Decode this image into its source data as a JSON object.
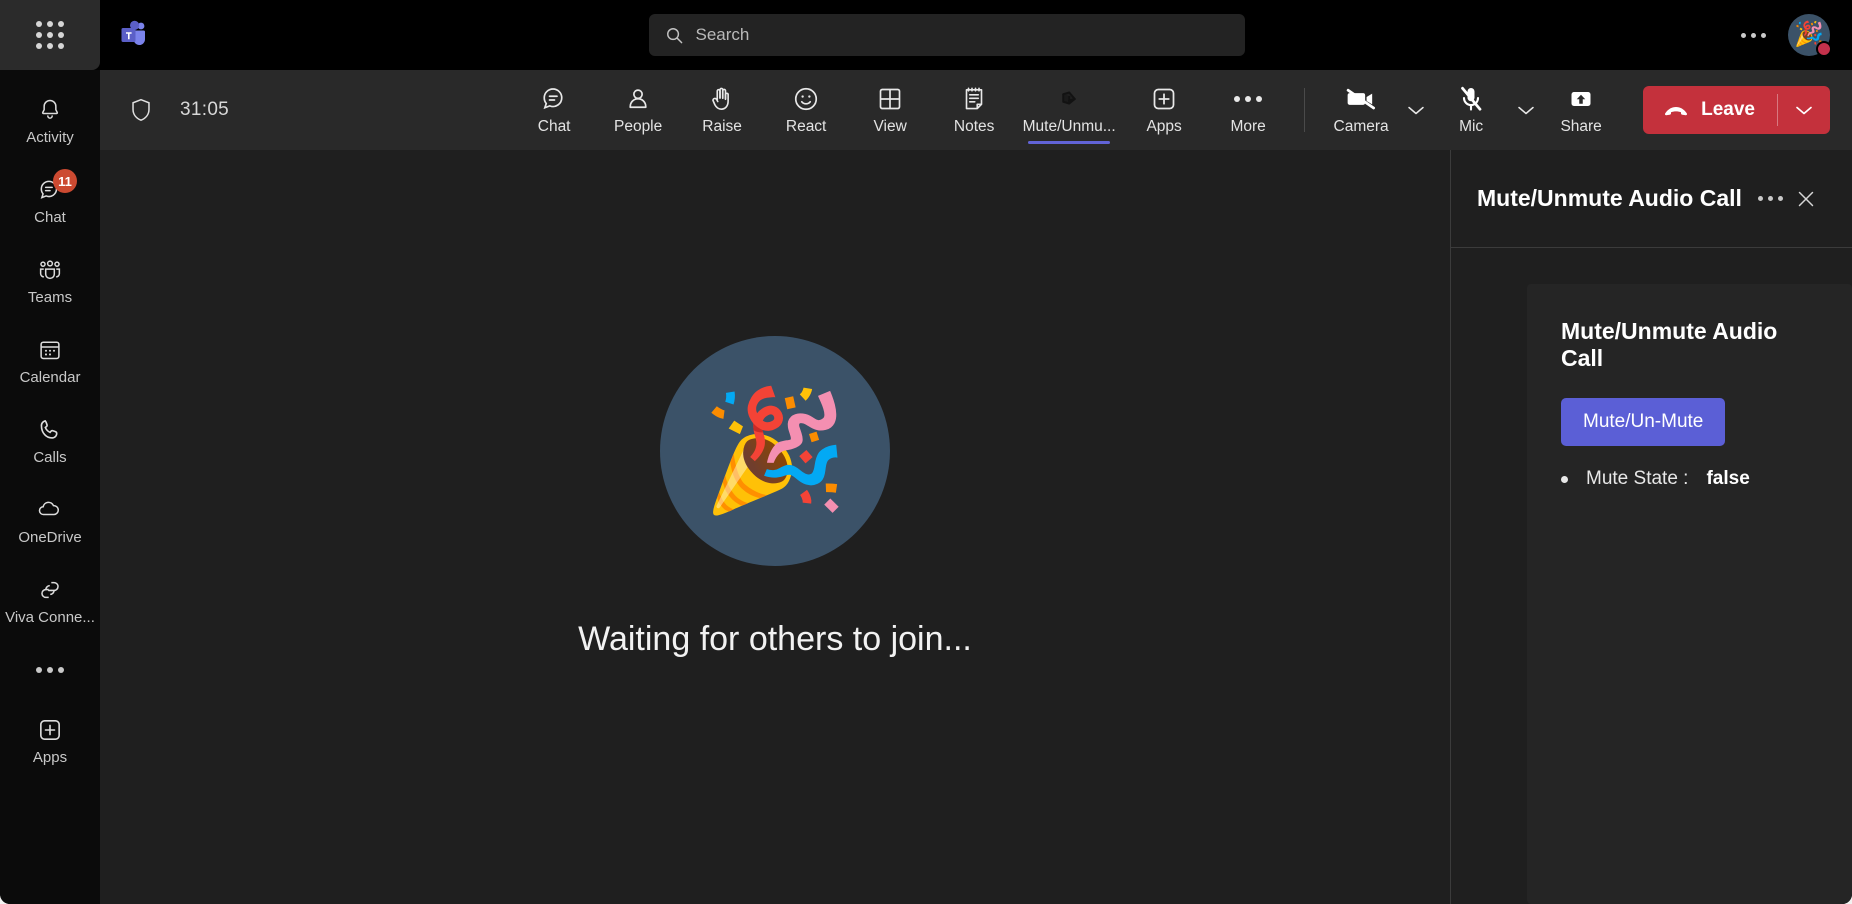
{
  "app": {
    "waffle_icon": "grid-waffle-icon",
    "logo_icon": "microsoft-teams-logo"
  },
  "search": {
    "placeholder": "Search",
    "value": "",
    "icon": "search-icon"
  },
  "titlebar": {
    "more_icon": "ellipsis-icon",
    "avatar_glyph": "🎉",
    "presence": "busy"
  },
  "sidebar": {
    "items": [
      {
        "label": "Activity",
        "icon": "bell-icon",
        "badge": ""
      },
      {
        "label": "Chat",
        "icon": "chat-bubble-icon",
        "badge": "11"
      },
      {
        "label": "Teams",
        "icon": "people-team-icon",
        "badge": ""
      },
      {
        "label": "Calendar",
        "icon": "calendar-icon",
        "badge": ""
      },
      {
        "label": "Calls",
        "icon": "phone-icon",
        "badge": ""
      },
      {
        "label": "OneDrive",
        "icon": "cloud-icon",
        "badge": ""
      },
      {
        "label": "Viva Conne...",
        "icon": "viva-connections-icon",
        "badge": ""
      }
    ],
    "more_icon": "ellipsis-icon",
    "apps": {
      "label": "Apps",
      "icon": "plus-square-icon"
    }
  },
  "meeting": {
    "shield_icon": "shield-icon",
    "timer": "31:05",
    "tools": [
      {
        "label": "Chat",
        "icon": "chat-icon",
        "active": false
      },
      {
        "label": "People",
        "icon": "person-icon",
        "active": false
      },
      {
        "label": "Raise",
        "icon": "raise-hand-icon",
        "active": false
      },
      {
        "label": "React",
        "icon": "smiley-icon",
        "active": false
      },
      {
        "label": "View",
        "icon": "grid-view-icon",
        "active": false
      },
      {
        "label": "Notes",
        "icon": "notes-icon",
        "active": false
      },
      {
        "label": "Mute/Unmu...",
        "icon": "mute-unmute-app-icon",
        "active": true
      },
      {
        "label": "Apps",
        "icon": "plus-square-icon",
        "active": false
      },
      {
        "label": "More",
        "icon": "ellipsis-icon",
        "active": false
      }
    ],
    "camera": {
      "label": "Camera",
      "icon": "camera-off-icon",
      "state": "off",
      "chevron_icon": "chevron-down-icon"
    },
    "mic": {
      "label": "Mic",
      "icon": "mic-off-icon",
      "state": "off",
      "chevron_icon": "chevron-down-icon"
    },
    "share": {
      "label": "Share",
      "icon": "share-screen-icon"
    },
    "leave": {
      "label": "Leave",
      "icon": "hangup-phone-icon",
      "chevron_icon": "chevron-down-icon",
      "color": "#c4313c"
    },
    "active_tab_accent": "#6264d8"
  },
  "stage": {
    "emoji": "🎉",
    "message": "Waiting for others to join...",
    "circle_color": "#3b5268"
  },
  "panel": {
    "title": "Mute/Unmute Audio Call",
    "more_icon": "ellipsis-icon",
    "close_icon": "close-icon",
    "card": {
      "title": "Mute/Unmute Audio Call",
      "button_label": "Mute/Un-Mute",
      "button_color": "#5b5fd6",
      "status_prefix": "Mute State : ",
      "status_value": "false"
    }
  }
}
